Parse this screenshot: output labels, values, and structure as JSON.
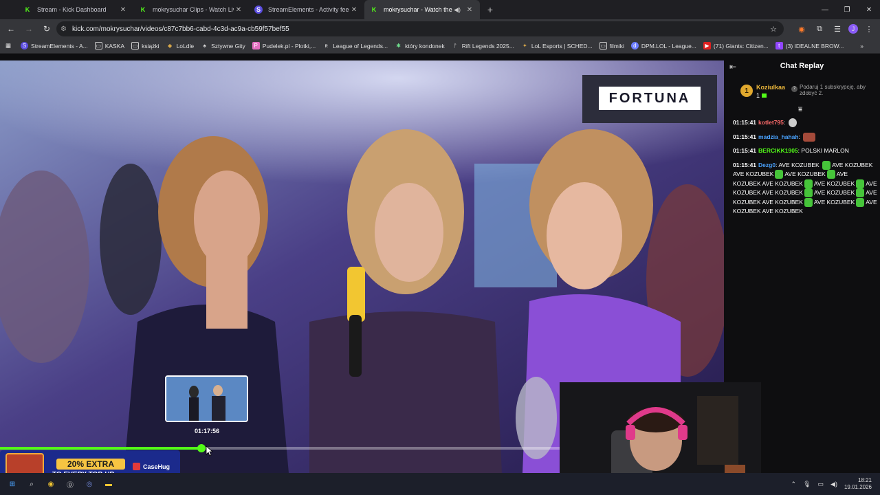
{
  "browser": {
    "tabs": [
      {
        "title": "Stream - Kick Dashboard",
        "icon": "kick-icon",
        "active": false
      },
      {
        "title": "mokrysuchar Clips - Watch Live",
        "icon": "kick-icon",
        "active": false
      },
      {
        "title": "StreamElements - Activity feed",
        "icon": "streamelements-icon",
        "active": false
      },
      {
        "title": "mokrysuchar - Watch the V",
        "icon": "kick-icon",
        "active": true
      }
    ],
    "url": "kick.com/mokrysuchar/videos/c87c7bb6-cabd-4c3d-ac9a-cb59f57bef55",
    "profile_initial": "J",
    "bookmarks": [
      "StreamElements - A...",
      "KASKA",
      "książki",
      "LoLdle",
      "Sztywne Gity",
      "Pudelek.pl - Plotki,...",
      "League of Legends...",
      "który kondonek",
      "Rift Legends 2025...",
      "LoL Esports | SCHED...",
      "filmiki",
      "DPM.LOL - League...",
      "(71) Giants: Citizen...",
      "(3) IDEALNE BROW..."
    ]
  },
  "video": {
    "sponsor_banner": "FORTUNA",
    "hover_time": "01:17:56",
    "progress_fraction": 0.36
  },
  "ad": {
    "headline": "20% EXTRA",
    "subline": "TO EVERY TOP-UP",
    "brand": "CaseHug"
  },
  "chat": {
    "title": "Chat Replay",
    "pinned": {
      "rank": "1",
      "username": "Koziulkaa",
      "count": "1",
      "gift_text": "Podaruj 1 subskrypcję, aby zdobyć 2."
    },
    "messages": [
      {
        "time": "01:15:41",
        "user": "kotlet795",
        "color": "#ff6b6b",
        "text": ""
      },
      {
        "time": "01:15:41",
        "user": "madzia_hahah",
        "color": "#4aa3ff",
        "text": ""
      },
      {
        "time": "01:15:41",
        "user": "BERCIKK1905",
        "color": "#53fc18",
        "text": "POLSKI MARLON"
      },
      {
        "time": "01:15:41",
        "user": "Dezg0",
        "color": "#4aa3ff",
        "text": "AVE KOZUBEK"
      }
    ],
    "spam_line": "AVE KOZUBEK"
  },
  "taskbar": {
    "time": "18:21",
    "date": "19.01.2026"
  },
  "colors": {
    "kick_green": "#53fc18",
    "chat_bg": "#0e0e10",
    "browser_chrome": "#35363a"
  }
}
